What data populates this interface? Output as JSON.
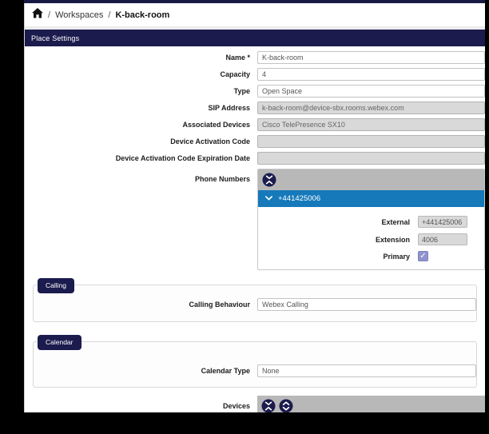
{
  "breadcrumb": {
    "separator": "/",
    "workspaces": "Workspaces",
    "current": "K-back-room"
  },
  "header": {
    "title": "Place Settings"
  },
  "form": {
    "fields": [
      {
        "label": "Name *",
        "value": "K-back-room",
        "disabled": false
      },
      {
        "label": "Capacity",
        "value": "4",
        "disabled": false
      },
      {
        "label": "Type",
        "value": "Open Space",
        "disabled": false
      },
      {
        "label": "SIP Address",
        "value": "k-back-room@device-sbx.rooms.webex.com",
        "disabled": true
      },
      {
        "label": "Associated Devices",
        "value": "Cisco TelePresence SX10",
        "disabled": true
      },
      {
        "label": "Device Activation Code",
        "value": "",
        "disabled": true
      },
      {
        "label": "Device Activation Code Expiration Date",
        "value": "",
        "disabled": true
      }
    ],
    "phone_numbers": {
      "label": "Phone Numbers",
      "entry": {
        "number": "+441425006",
        "fields": [
          {
            "label": "External",
            "value": "+441425006"
          },
          {
            "label": "Extension",
            "value": "4006"
          }
        ],
        "primary_label": "Primary",
        "primary_checked": true
      }
    }
  },
  "sections": {
    "calling": {
      "title": "Calling",
      "rows": [
        {
          "label": "Calling Behaviour",
          "value": "Webex Calling"
        }
      ]
    },
    "calendar": {
      "title": "Calendar",
      "rows": [
        {
          "label": "Calendar Type",
          "value": "None"
        }
      ]
    }
  },
  "devices": {
    "label": "Devices"
  },
  "icons": {
    "home": "home-icon",
    "collapse_all": "chevrons-inward-circle",
    "expand_all": "chevrons-outward-circle",
    "chevron_down": "chevron-down",
    "checkmark": "✓"
  },
  "colors": {
    "navy": "#1b1b4e",
    "blue_bar": "#1579ba",
    "gray_bar": "#b8b8b8",
    "disabled_input": "#d9d9d9",
    "checkbox": "#9193cf"
  }
}
